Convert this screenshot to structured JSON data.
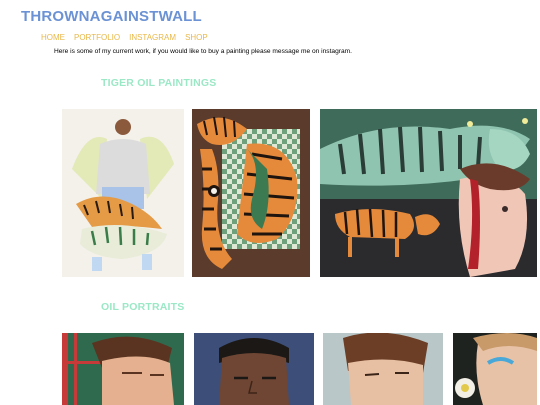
{
  "header": {
    "site_title": "THROWNAGAINSTWALL"
  },
  "nav": {
    "items": [
      {
        "label": "HOME"
      },
      {
        "label": "PORTFOLIO"
      },
      {
        "label": "INSTAGRAM"
      },
      {
        "label": "SHOP"
      }
    ]
  },
  "intro": {
    "text": "Here is some of my current work, if you would like to buy a painting please message me on instagram."
  },
  "sections": [
    {
      "heading": "TIGER OIL PAINTINGS"
    },
    {
      "heading": "OIL PORTRAITS"
    }
  ],
  "colors": {
    "title": "#6b92d4",
    "nav": "#e8b84a",
    "section_heading": "#9be8c6"
  }
}
